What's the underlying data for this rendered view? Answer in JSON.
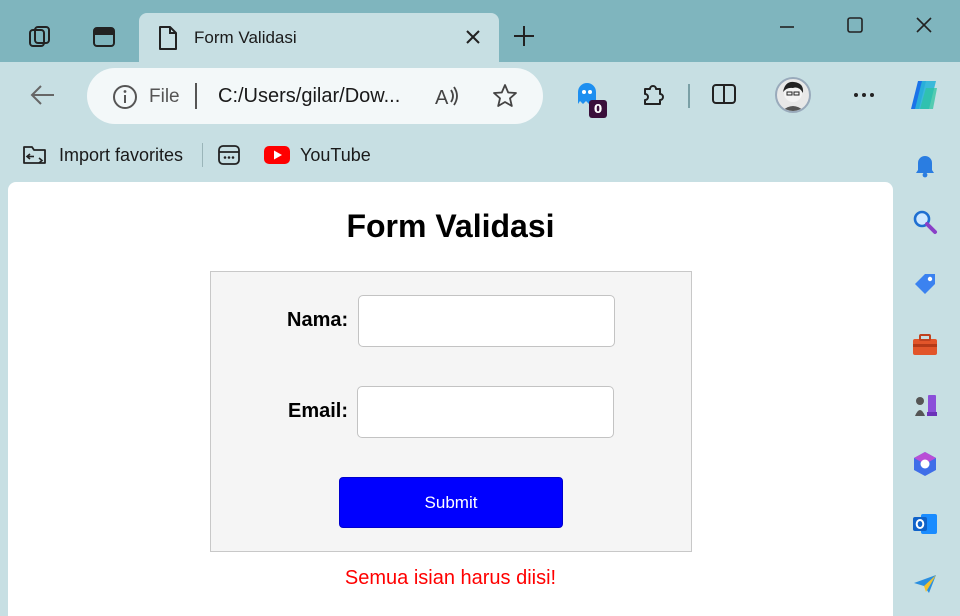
{
  "browser": {
    "tab_title": "Form Validasi",
    "address": {
      "scheme_label": "File",
      "url": "C:/Users/gilar/Dow..."
    },
    "extension_badge": "0",
    "favorites": [
      {
        "label": "Import favorites",
        "icon": "import-favorites-icon"
      },
      {
        "label": "",
        "icon": "collections-icon"
      },
      {
        "label": "YouTube",
        "icon": "youtube-icon"
      }
    ],
    "colors": {
      "titlebar": "#7fb5be",
      "toolbar": "#c7dfe3",
      "accent": "#0000ff",
      "error": "#ff0000"
    }
  },
  "form": {
    "title": "Form Validasi",
    "name_label": "Nama:",
    "name_value": "",
    "email_label": "Email:",
    "email_value": "",
    "submit_label": "Submit",
    "error_message": "Semua isian harus diisi!"
  }
}
